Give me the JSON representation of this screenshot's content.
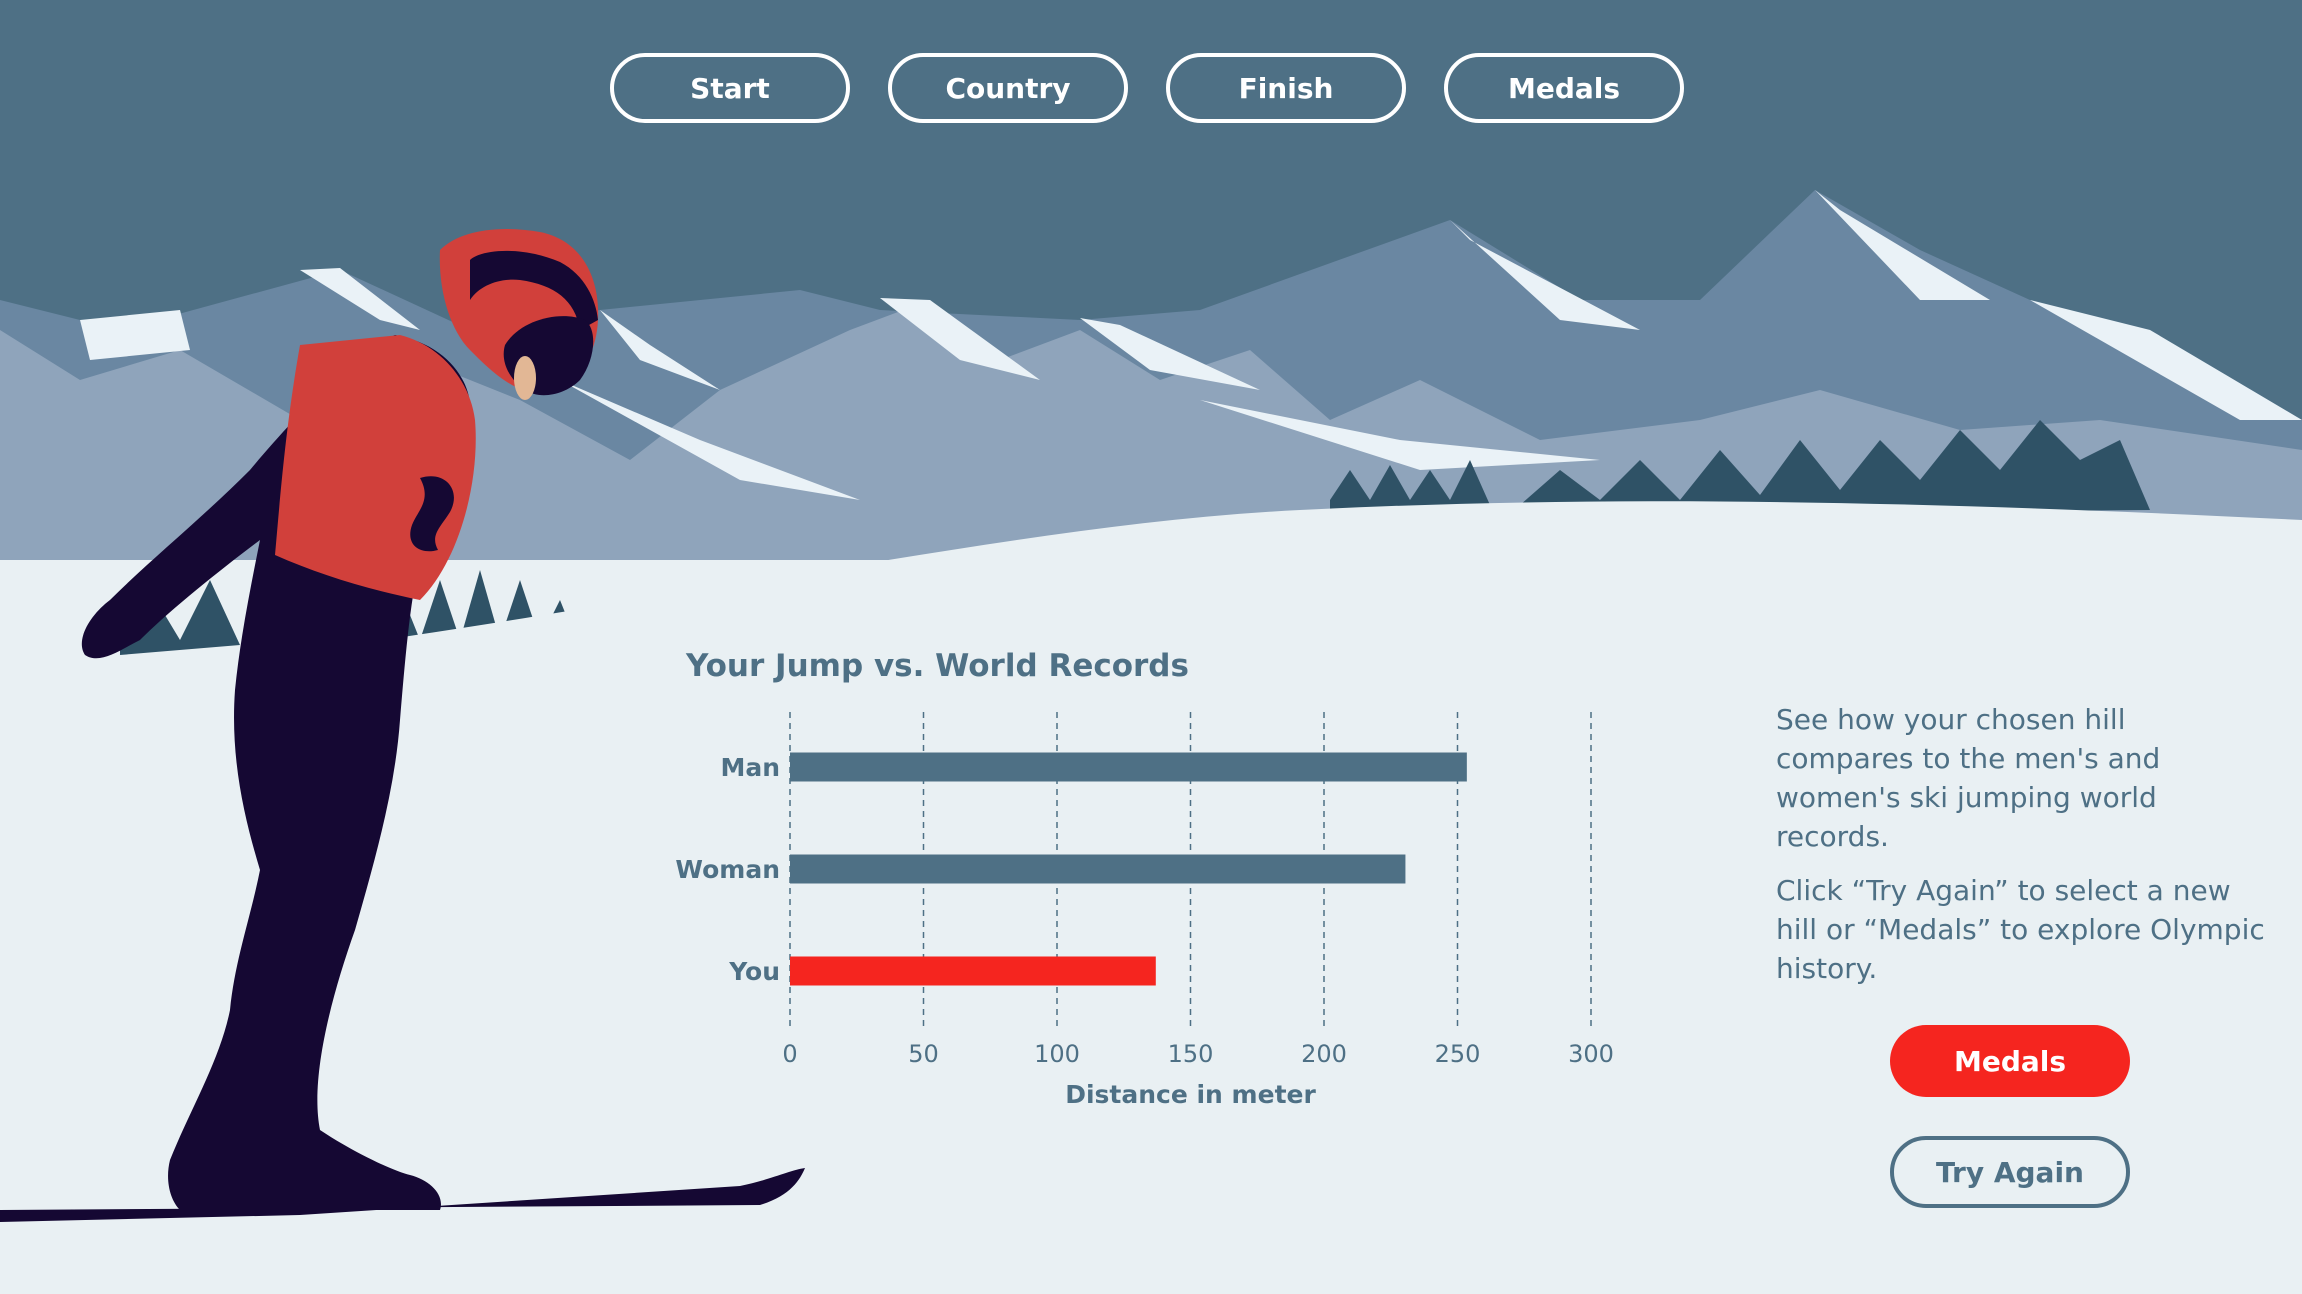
{
  "nav": {
    "start_label": "Start",
    "country_label": "Country",
    "finish_label": "Finish",
    "medals_label": "Medals"
  },
  "info": {
    "paragraph_1": "See how your chosen hill compares to the men's and women's ski jumping world records.",
    "paragraph_2": "Click “Try Again” to select a new hill or “Medals” to explore Olympic history."
  },
  "actions": {
    "medals_label": "Medals",
    "try_again_label": "Try Again"
  },
  "colors": {
    "sky": "#4e7085",
    "snow": "#e9f0f3",
    "record_bar": "#4e7085",
    "you_bar": "#f5251f",
    "skier_suit": "#150833",
    "skier_accent": "#d1403b"
  },
  "chart_data": {
    "type": "bar",
    "orientation": "horizontal",
    "title": "Your Jump vs. World Records",
    "xlabel": "Distance in meter",
    "ylabel": "",
    "categories": [
      "Man",
      "Woman",
      "You"
    ],
    "values": [
      253.5,
      230.5,
      137
    ],
    "bar_colors": [
      "#4e7085",
      "#4e7085",
      "#f5251f"
    ],
    "xlim": [
      0,
      300
    ],
    "xticks": [
      0,
      50,
      100,
      150,
      200,
      250,
      300
    ],
    "grid": "vertical dashed"
  }
}
